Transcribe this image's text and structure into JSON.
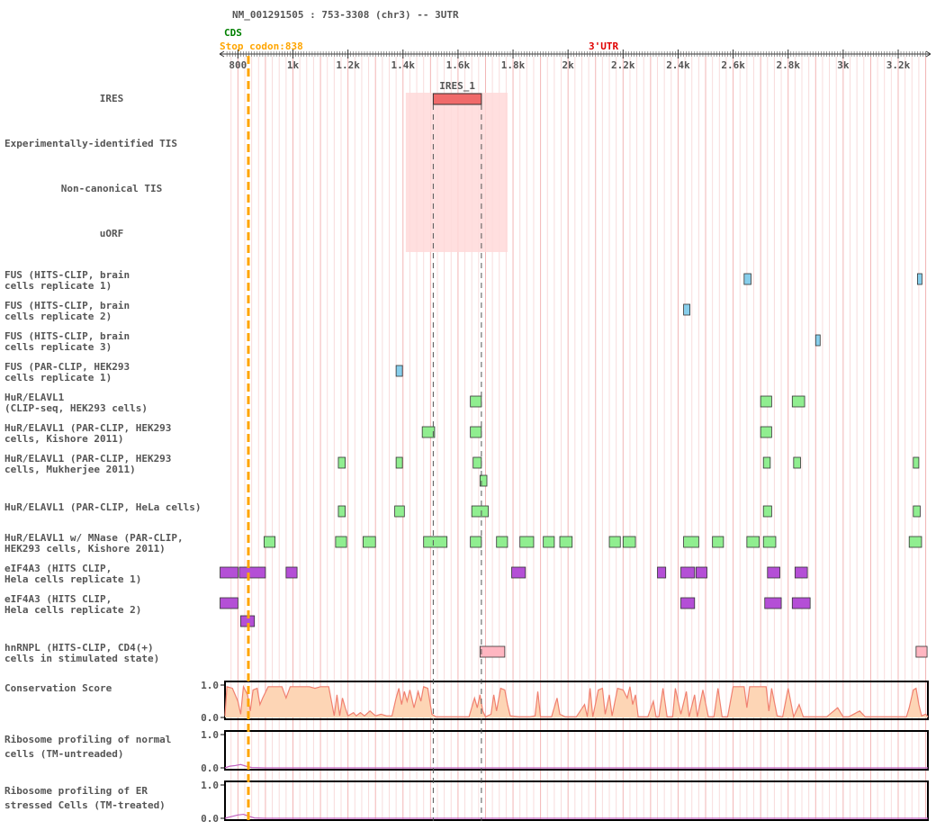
{
  "header": {
    "transcript": "NM_001291505 : 753-3308 (chr3) -- 3UTR",
    "cds_label": "CDS",
    "stop_codon_label": "Stop codon:838",
    "utr_label": "3'UTR"
  },
  "colors": {
    "cds": "#008000",
    "stop": "#ffa500",
    "utr": "#ff0000",
    "ires": "#f06a6a",
    "ires_highlight": "#ffd9d9",
    "fus": "#87ceeb",
    "hur": "#90ee90",
    "eif4a3": "#b44fd6",
    "hnrnpl": "#ffb6c1",
    "conservation_fill": "#fdd5b5",
    "conservation_line": "#f08070",
    "ribosome_line": "#c060c0"
  },
  "axis": {
    "start": 753,
    "end": 3308,
    "stop_codon": 838,
    "ticks": [
      {
        "pos": 800,
        "label": "800"
      },
      {
        "pos": 1000,
        "label": "1k"
      },
      {
        "pos": 1200,
        "label": "1.2k"
      },
      {
        "pos": 1400,
        "label": "1.4k"
      },
      {
        "pos": 1600,
        "label": "1.6k"
      },
      {
        "pos": 1800,
        "label": "1.8k"
      },
      {
        "pos": 2000,
        "label": "2k"
      },
      {
        "pos": 2200,
        "label": "2.2k"
      },
      {
        "pos": 2400,
        "label": "2.4k"
      },
      {
        "pos": 2600,
        "label": "2.6k"
      },
      {
        "pos": 2800,
        "label": "2.8k"
      },
      {
        "pos": 3000,
        "label": "3k"
      },
      {
        "pos": 3200,
        "label": "3.2k"
      }
    ]
  },
  "ires_feature": {
    "label": "IRES_1",
    "start": 1510,
    "end": 1685
  },
  "ires_highlight": {
    "start": 1410,
    "end": 1780
  },
  "tracks": [
    {
      "name": "track-ires",
      "lines": [
        "IRES"
      ],
      "align": "center"
    },
    {
      "name": "track-experimental-tis",
      "lines": [
        "Experimentally-identified TIS"
      ],
      "align": "left"
    },
    {
      "name": "track-noncanonical-tis",
      "lines": [
        "Non-canonical TIS"
      ],
      "align": "center"
    },
    {
      "name": "track-uorf",
      "lines": [
        "uORF"
      ],
      "align": "center"
    },
    {
      "name": "track-fus-brain-1",
      "lines": [
        "FUS (HITS-CLIP, brain",
        "cells replicate 1)"
      ],
      "align": "left"
    },
    {
      "name": "track-fus-brain-2",
      "lines": [
        "FUS (HITS-CLIP, brain",
        "cells replicate 2)"
      ],
      "align": "left"
    },
    {
      "name": "track-fus-brain-3",
      "lines": [
        "FUS (HITS-CLIP, brain",
        "cells replicate 3)"
      ],
      "align": "left"
    },
    {
      "name": "track-fus-hek293",
      "lines": [
        "FUS (PAR-CLIP, HEK293",
        "cells replicate 1)"
      ],
      "align": "left"
    },
    {
      "name": "track-hur-clipseq",
      "lines": [
        "HuR/ELAVL1",
        "(CLIP-seq, HEK293 cells)"
      ],
      "align": "left"
    },
    {
      "name": "track-hur-kishore",
      "lines": [
        "HuR/ELAVL1 (PAR-CLIP, HEK293",
        "cells, Kishore 2011)"
      ],
      "align": "left"
    },
    {
      "name": "track-hur-mukherjee",
      "lines": [
        "HuR/ELAVL1 (PAR-CLIP, HEK293",
        "cells, Mukherjee 2011)"
      ],
      "align": "left"
    },
    {
      "name": "track-hur-hela",
      "lines": [
        "HuR/ELAVL1 (PAR-CLIP, HeLa cells)"
      ],
      "align": "left"
    },
    {
      "name": "track-hur-mnase",
      "lines": [
        "HuR/ELAVL1 w/ MNase (PAR-CLIP,",
        "HEK293 cells, Kishore 2011)"
      ],
      "align": "left"
    },
    {
      "name": "track-eif4a3-rep1",
      "lines": [
        "eIF4A3 (HITS CLIP,",
        "Hela cells replicate 1)"
      ],
      "align": "left"
    },
    {
      "name": "track-eif4a3-rep2",
      "lines": [
        "eIF4A3 (HITS CLIP,",
        "Hela cells replicate 2)"
      ],
      "align": "left"
    },
    {
      "name": "track-hnrnpl",
      "lines": [
        "hnRNPL (HITS-CLIP, CD4(+)",
        "cells in stimulated state)"
      ],
      "align": "left"
    },
    {
      "name": "track-conservation",
      "lines": [
        "Conservation Score"
      ],
      "align": "left"
    },
    {
      "name": "track-ribo-normal",
      "lines": [
        "Ribosome profiling of normal",
        "cells (TM-untreaded)"
      ],
      "align": "left"
    },
    {
      "name": "track-ribo-er",
      "lines": [
        "Ribosome profiling of ER",
        "stressed Cells (TM-treated)"
      ],
      "align": "left"
    }
  ],
  "features": {
    "fus_brain_1": [
      [
        2640,
        2665
      ],
      [
        3270,
        3285
      ]
    ],
    "fus_brain_2": [
      [
        2420,
        2443
      ]
    ],
    "fus_brain_3": [
      [
        2900,
        2913
      ]
    ],
    "fus_hek293": [
      [
        1375,
        1398
      ]
    ],
    "hur_clipseq": [
      [
        1645,
        1685
      ],
      [
        2700,
        2740
      ],
      [
        2815,
        2860
      ]
    ],
    "hur_kishore": [
      [
        1470,
        1515
      ],
      [
        1645,
        1685
      ],
      [
        2700,
        2740
      ]
    ],
    "hur_mukherjee": [
      [
        1165,
        1190
      ],
      [
        1375,
        1398
      ],
      [
        1655,
        1685
      ],
      [
        2710,
        2735
      ],
      [
        2820,
        2845
      ],
      [
        3255,
        3275
      ]
    ],
    "hur_mukherjee_row2": [
      [
        1680,
        1705
      ]
    ],
    "hur_hela": [
      [
        1165,
        1190
      ],
      [
        1370,
        1405
      ],
      [
        1650,
        1710
      ],
      [
        2710,
        2740
      ],
      [
        3255,
        3280
      ]
    ],
    "hur_mnase": [
      [
        895,
        935
      ],
      [
        1155,
        1195
      ],
      [
        1255,
        1300
      ],
      [
        1475,
        1560
      ],
      [
        1645,
        1685
      ],
      [
        1740,
        1780
      ],
      [
        1825,
        1875
      ],
      [
        1910,
        1950
      ],
      [
        1970,
        2015
      ],
      [
        2150,
        2190
      ],
      [
        2200,
        2245
      ],
      [
        2420,
        2475
      ],
      [
        2525,
        2565
      ],
      [
        2650,
        2695
      ],
      [
        2710,
        2755
      ],
      [
        3240,
        3285
      ]
    ],
    "eif4a3_rep1": [
      [
        735,
        800
      ],
      [
        805,
        900
      ],
      [
        975,
        1015
      ],
      [
        1795,
        1845
      ],
      [
        2325,
        2355
      ],
      [
        2410,
        2460
      ],
      [
        2465,
        2505
      ],
      [
        2725,
        2770
      ],
      [
        2825,
        2870
      ]
    ],
    "eif4a3_rep1_row2": [],
    "eif4a3_rep2": [
      [
        735,
        800
      ],
      [
        2410,
        2460
      ],
      [
        2715,
        2775
      ],
      [
        2815,
        2880
      ]
    ],
    "eif4a3_rep2_row2": [
      [
        810,
        860
      ]
    ],
    "hnrnpl": [
      [
        1680,
        1770
      ],
      [
        3265,
        3305
      ]
    ]
  },
  "conservation": {
    "ylabels": [
      "1.0",
      "0.0"
    ],
    "profile": [
      [
        753,
        0.05
      ],
      [
        760,
        0.95
      ],
      [
        780,
        0.9
      ],
      [
        800,
        0.5
      ],
      [
        810,
        0.1
      ],
      [
        820,
        0.95
      ],
      [
        835,
        0.7
      ],
      [
        845,
        0.2
      ],
      [
        855,
        0.85
      ],
      [
        870,
        0.9
      ],
      [
        880,
        0.4
      ],
      [
        890,
        0.6
      ],
      [
        910,
        0.95
      ],
      [
        960,
        0.95
      ],
      [
        975,
        0.6
      ],
      [
        990,
        0.95
      ],
      [
        1000,
        0.95
      ],
      [
        1030,
        0.95
      ],
      [
        1060,
        0.95
      ],
      [
        1080,
        0.9
      ],
      [
        1100,
        0.95
      ],
      [
        1130,
        0.95
      ],
      [
        1140,
        0.5
      ],
      [
        1150,
        0.05
      ],
      [
        1160,
        0.7
      ],
      [
        1170,
        0.05
      ],
      [
        1180,
        0.6
      ],
      [
        1190,
        0.3
      ],
      [
        1200,
        0.05
      ],
      [
        1220,
        0.15
      ],
      [
        1230,
        0.05
      ],
      [
        1245,
        0.15
      ],
      [
        1260,
        0.05
      ],
      [
        1280,
        0.2
      ],
      [
        1300,
        0.05
      ],
      [
        1320,
        0.1
      ],
      [
        1340,
        0.05
      ],
      [
        1360,
        0.05
      ],
      [
        1375,
        0.6
      ],
      [
        1385,
        0.9
      ],
      [
        1395,
        0.4
      ],
      [
        1405,
        0.8
      ],
      [
        1415,
        0.5
      ],
      [
        1425,
        0.85
      ],
      [
        1440,
        0.3
      ],
      [
        1455,
        0.8
      ],
      [
        1465,
        0.5
      ],
      [
        1475,
        0.95
      ],
      [
        1490,
        0.9
      ],
      [
        1505,
        0.1
      ],
      [
        1520,
        0.02
      ],
      [
        1560,
        0.02
      ],
      [
        1600,
        0.02
      ],
      [
        1640,
        0.02
      ],
      [
        1660,
        0.6
      ],
      [
        1670,
        0.3
      ],
      [
        1680,
        0.7
      ],
      [
        1690,
        0.2
      ],
      [
        1700,
        0.02
      ],
      [
        1720,
        0.1
      ],
      [
        1730,
        0.7
      ],
      [
        1740,
        0.2
      ],
      [
        1755,
        0.9
      ],
      [
        1770,
        0.85
      ],
      [
        1780,
        0.4
      ],
      [
        1790,
        0.05
      ],
      [
        1820,
        0.02
      ],
      [
        1860,
        0.02
      ],
      [
        1880,
        0.05
      ],
      [
        1890,
        0.8
      ],
      [
        1900,
        0.02
      ],
      [
        1940,
        0.02
      ],
      [
        1960,
        0.6
      ],
      [
        1970,
        0.1
      ],
      [
        1990,
        0.02
      ],
      [
        2030,
        0.02
      ],
      [
        2060,
        0.4
      ],
      [
        2070,
        0.02
      ],
      [
        2080,
        0.9
      ],
      [
        2090,
        0.02
      ],
      [
        2110,
        0.85
      ],
      [
        2125,
        0.9
      ],
      [
        2135,
        0.1
      ],
      [
        2150,
        0.7
      ],
      [
        2160,
        0.05
      ],
      [
        2180,
        0.9
      ],
      [
        2200,
        0.85
      ],
      [
        2215,
        0.6
      ],
      [
        2225,
        0.95
      ],
      [
        2235,
        0.4
      ],
      [
        2245,
        0.7
      ],
      [
        2255,
        0.02
      ],
      [
        2290,
        0.02
      ],
      [
        2310,
        0.5
      ],
      [
        2320,
        0.02
      ],
      [
        2330,
        0.02
      ],
      [
        2345,
        0.9
      ],
      [
        2360,
        0.02
      ],
      [
        2380,
        0.02
      ],
      [
        2390,
        0.9
      ],
      [
        2410,
        0.1
      ],
      [
        2430,
        0.8
      ],
      [
        2440,
        0.02
      ],
      [
        2460,
        0.7
      ],
      [
        2470,
        0.02
      ],
      [
        2490,
        0.85
      ],
      [
        2510,
        0.02
      ],
      [
        2530,
        0.02
      ],
      [
        2545,
        0.9
      ],
      [
        2560,
        0.02
      ],
      [
        2580,
        0.02
      ],
      [
        2600,
        0.95
      ],
      [
        2640,
        0.95
      ],
      [
        2650,
        0.3
      ],
      [
        2660,
        0.95
      ],
      [
        2700,
        0.95
      ],
      [
        2720,
        0.95
      ],
      [
        2730,
        0.2
      ],
      [
        2740,
        0.9
      ],
      [
        2760,
        0.05
      ],
      [
        2780,
        0.02
      ],
      [
        2800,
        0.9
      ],
      [
        2820,
        0.02
      ],
      [
        2840,
        0.4
      ],
      [
        2855,
        0.02
      ],
      [
        2870,
        0.02
      ],
      [
        2900,
        0.02
      ],
      [
        2940,
        0.02
      ],
      [
        2980,
        0.3
      ],
      [
        3000,
        0.02
      ],
      [
        3020,
        0.02
      ],
      [
        3060,
        0.2
      ],
      [
        3080,
        0.02
      ],
      [
        3100,
        0.02
      ],
      [
        3150,
        0.02
      ],
      [
        3200,
        0.02
      ],
      [
        3230,
        0.02
      ],
      [
        3240,
        0.3
      ],
      [
        3255,
        0.85
      ],
      [
        3265,
        0.9
      ],
      [
        3275,
        0.4
      ],
      [
        3285,
        0.05
      ],
      [
        3300,
        0.1
      ],
      [
        3308,
        0.02
      ]
    ]
  },
  "ribosome_normal": {
    "ylabels": [
      "1.0",
      "0.0"
    ],
    "profile": [
      [
        753,
        0.0
      ],
      [
        770,
        0.05
      ],
      [
        790,
        0.07
      ],
      [
        810,
        0.1
      ],
      [
        830,
        0.05
      ],
      [
        850,
        0.01
      ],
      [
        900,
        0.0
      ],
      [
        3308,
        0.0
      ]
    ]
  },
  "ribosome_er": {
    "ylabels": [
      "1.0",
      "0.0"
    ],
    "profile": [
      [
        753,
        0.0
      ],
      [
        770,
        0.04
      ],
      [
        800,
        0.1
      ],
      [
        820,
        0.12
      ],
      [
        840,
        0.06
      ],
      [
        860,
        0.01
      ],
      [
        900,
        0.0
      ],
      [
        3308,
        0.0
      ]
    ]
  }
}
